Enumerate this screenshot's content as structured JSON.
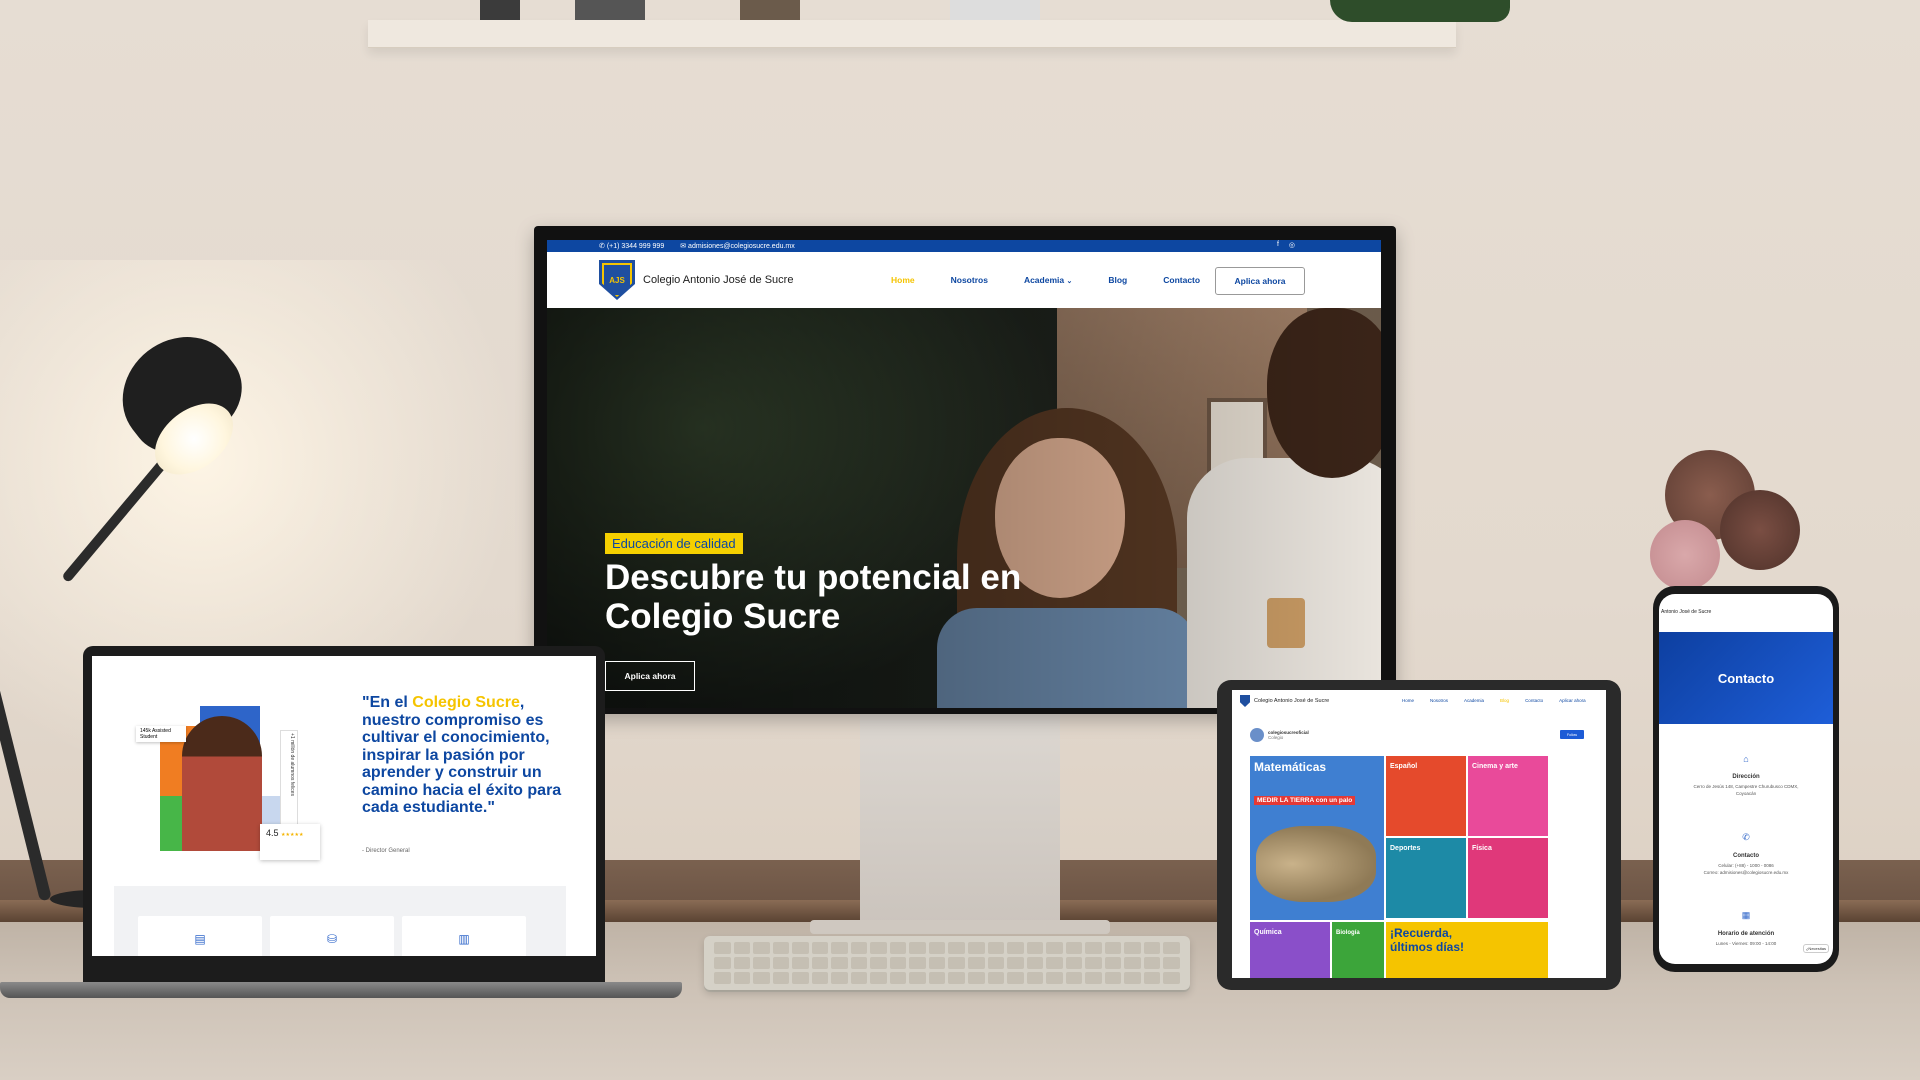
{
  "monitor": {
    "topbar": {
      "phone": "(+1) 3344 999 999",
      "email": "admisiones@colegiosucre.edu.mx",
      "social": [
        "f",
        "◎"
      ]
    },
    "nav": {
      "logo": "AJS",
      "brand": "Colegio Antonio José de Sucre",
      "menu": [
        "Home",
        "Nosotros",
        "Academia",
        "Blog",
        "Contacto"
      ],
      "active": "Home",
      "dropdown_caret": "⌄",
      "cta": "Aplica ahora"
    },
    "hero": {
      "badge": "Educación de calidad",
      "title": "Descubre tu potencial en Colegio Sucre",
      "button": "Aplica ahora"
    }
  },
  "laptop": {
    "quote_open": "\"En el ",
    "quote_highlight": "Colegio Sucre",
    "quote_rest": ", nuestro compromiso es cultivar el conocimiento, inspirar la pasión por aprender y construir un camino hacia el éxito para cada estudiante.\"",
    "author": "- Director General",
    "mini_card": "145k Assisted Student",
    "side_label": "+1 millón de alumnos felices",
    "rating": "4.5",
    "stars": "★★★★★",
    "tile_icons": [
      "▤",
      "⛁",
      "▥"
    ]
  },
  "tablet": {
    "brand": "Colegio Antonio José de Sucre",
    "menu": [
      "Home",
      "Nosotros",
      "Academia",
      "Blog",
      "Contacto",
      "Aplicar ahora"
    ],
    "active": "Blog",
    "profile_name": "colegiosucreoficial",
    "profile_sub": "Colegio",
    "follow": "Follow",
    "cells": [
      {
        "title": "Matemáticas",
        "sub": "MEDIR LA TIERRA con un palo",
        "color": "#3f7fd1"
      },
      {
        "title": "Español",
        "sub": "",
        "color": "#e54a2c"
      },
      {
        "title": "Cinema y arte",
        "sub": "",
        "color": "#e94a9a"
      },
      {
        "title": "Deportes",
        "sub": "",
        "color": "#1d8aa6"
      },
      {
        "title": "Física",
        "sub": "",
        "color": "#e0387a"
      },
      {
        "title": "Química",
        "sub": "",
        "color": "#8a4fc9"
      },
      {
        "title": "Biología",
        "sub": "",
        "color": "#3ca53a"
      },
      {
        "title": "¡Recuerda, últimos días!",
        "sub": "",
        "color": "#f5c400"
      }
    ]
  },
  "phone": {
    "brand": "Antonio José de Sucre",
    "hero_title": "Contacto",
    "direccion_title": "Dirección",
    "direccion": "Cerro de Jesús 148, Campestre Churubusco CDMX, Coyoacán",
    "contacto_title": "Contacto",
    "contacto_cel": "Celular: (+88) - 1000 - 0086",
    "contacto_correo": "Correo: admisiones@colegiosucre.edu.mx",
    "horario_title": "Horario de atención",
    "horario": "Lunes - Viernes: 09:00 - 14:00",
    "chip": "¿Necesitas"
  }
}
